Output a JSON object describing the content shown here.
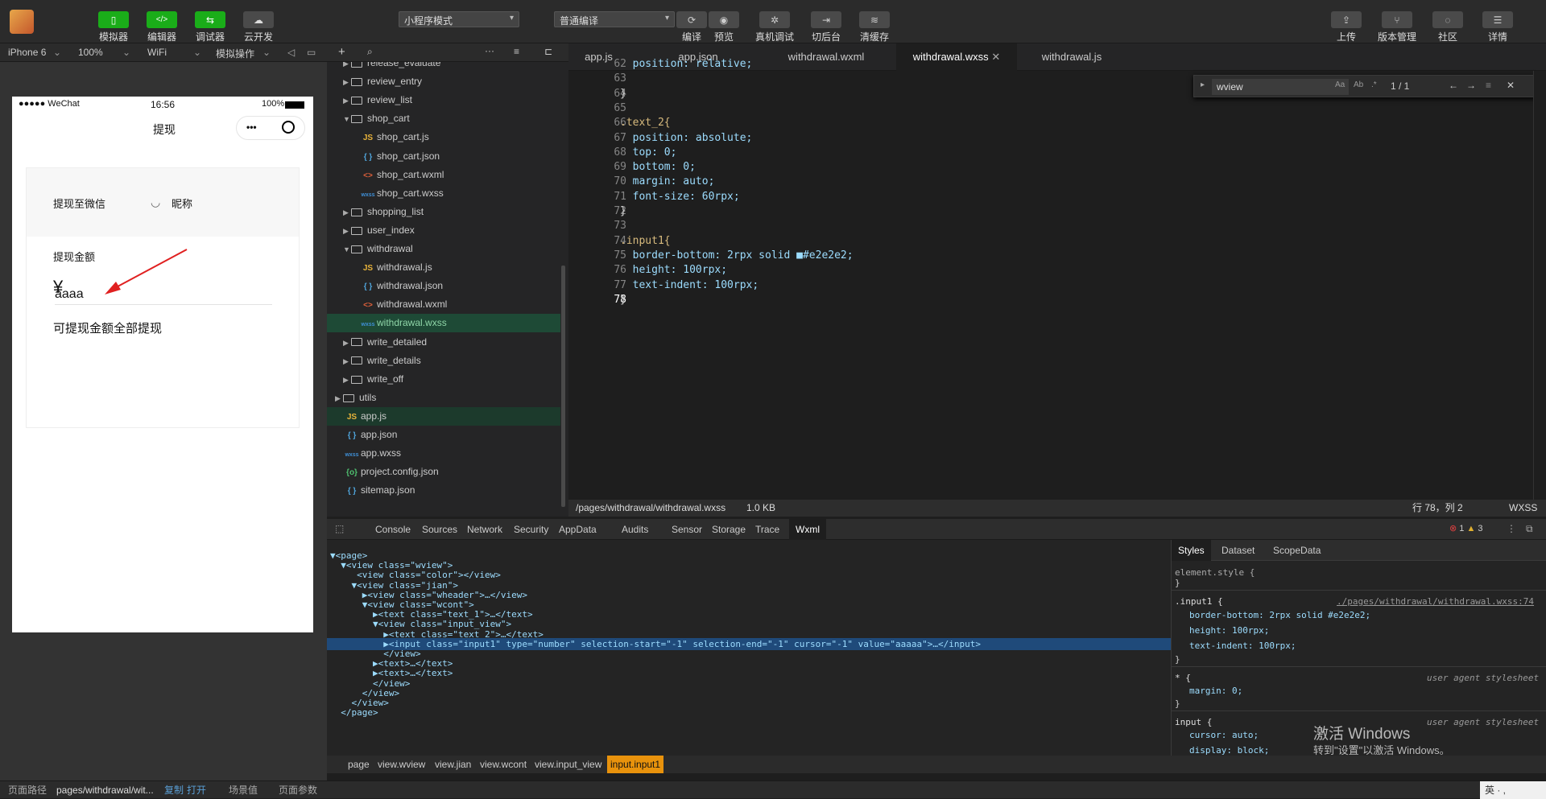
{
  "toolbar": {
    "buttons": [
      {
        "label": "模拟器"
      },
      {
        "label": "编辑器"
      },
      {
        "label": "调试器"
      },
      {
        "label": "云开发"
      }
    ],
    "mode": "小程序模式",
    "compile": "普通编译",
    "actions": [
      {
        "label": "编译"
      },
      {
        "label": "预览"
      },
      {
        "label": "真机调试"
      },
      {
        "label": "切后台"
      },
      {
        "label": "清缓存"
      }
    ],
    "right": [
      {
        "label": "上传"
      },
      {
        "label": "版本管理"
      },
      {
        "label": "社区"
      },
      {
        "label": "详情"
      }
    ]
  },
  "devbar": {
    "device": "iPhone 6",
    "zoom": "100%",
    "network": "WiFi",
    "ops": "模拟操作"
  },
  "tabs": [
    "app.js",
    "app.json",
    "withdrawal.wxml",
    "withdrawal.wxss",
    "withdrawal.js"
  ],
  "phone": {
    "signal": "●●●●● WeChat",
    "time": "16:56",
    "battery": "100%",
    "title": "提现",
    "to_wechat": "提现至微信",
    "nickname": "昵称",
    "amount_label": "提现金额",
    "yen": "¥",
    "input_value": "aaaa",
    "available": "可提现金额全部提现"
  },
  "files": [
    {
      "name": "release_evaluate",
      "type": "folder",
      "indent": 1,
      "open": false
    },
    {
      "name": "review_entry",
      "type": "folder",
      "indent": 1,
      "open": false
    },
    {
      "name": "review_list",
      "type": "folder",
      "indent": 1,
      "open": false
    },
    {
      "name": "shop_cart",
      "type": "folder",
      "indent": 1,
      "open": true
    },
    {
      "name": "shop_cart.js",
      "type": "js",
      "indent": 2
    },
    {
      "name": "shop_cart.json",
      "type": "json",
      "indent": 2
    },
    {
      "name": "shop_cart.wxml",
      "type": "wxml",
      "indent": 2
    },
    {
      "name": "shop_cart.wxss",
      "type": "wxss",
      "indent": 2
    },
    {
      "name": "shopping_list",
      "type": "folder",
      "indent": 1,
      "open": false
    },
    {
      "name": "user_index",
      "type": "folder",
      "indent": 1,
      "open": false
    },
    {
      "name": "withdrawal",
      "type": "folder",
      "indent": 1,
      "open": true
    },
    {
      "name": "withdrawal.js",
      "type": "js",
      "indent": 2
    },
    {
      "name": "withdrawal.json",
      "type": "json",
      "indent": 2
    },
    {
      "name": "withdrawal.wxml",
      "type": "wxml",
      "indent": 2
    },
    {
      "name": "withdrawal.wxss",
      "type": "wxss",
      "indent": 2
    },
    {
      "name": "write_detailed",
      "type": "folder",
      "indent": 1,
      "open": false
    },
    {
      "name": "write_details",
      "type": "folder",
      "indent": 1,
      "open": false
    },
    {
      "name": "write_off",
      "type": "folder",
      "indent": 1,
      "open": false
    },
    {
      "name": "utils",
      "type": "folder",
      "indent": 0,
      "open": false
    },
    {
      "name": "app.js",
      "type": "js",
      "indent": 0
    },
    {
      "name": "app.json",
      "type": "json",
      "indent": 0
    },
    {
      "name": "app.wxss",
      "type": "wxss",
      "indent": 0
    },
    {
      "name": "project.config.json",
      "type": "cfg",
      "indent": 0
    },
    {
      "name": "sitemap.json",
      "type": "json",
      "indent": 0
    }
  ],
  "code": [
    {
      "n": "62",
      "t": "  position: relative;"
    },
    {
      "n": "63",
      "t": ""
    },
    {
      "n": "64",
      "t": "}"
    },
    {
      "n": "65",
      "t": ""
    },
    {
      "n": "66",
      "t": ".text_2{"
    },
    {
      "n": "67",
      "t": "  position: absolute;"
    },
    {
      "n": "68",
      "t": "  top: 0;"
    },
    {
      "n": "69",
      "t": "  bottom: 0;"
    },
    {
      "n": "70",
      "t": "  margin: auto;"
    },
    {
      "n": "71",
      "t": "  font-size: 60rpx;"
    },
    {
      "n": "72",
      "t": "}"
    },
    {
      "n": "73",
      "t": ""
    },
    {
      "n": "74",
      "t": ".input1{"
    },
    {
      "n": "75",
      "t": "  border-bottom: 2rpx solid ■#e2e2e2;"
    },
    {
      "n": "76",
      "t": "  height: 100rpx;"
    },
    {
      "n": "77",
      "t": "  text-indent: 100rpx;"
    },
    {
      "n": "78",
      "t": "}"
    }
  ],
  "find": {
    "query": "wview",
    "count": "1 / 1"
  },
  "status": {
    "path": "/pages/withdrawal/withdrawal.wxss",
    "size": "1.0 KB",
    "pos": "行 78，列 2",
    "lang": "WXSS"
  },
  "devtabs": [
    "Console",
    "Sources",
    "Network",
    "Security",
    "AppData",
    "Audits",
    "Sensor",
    "Storage",
    "Trace",
    "Wxml"
  ],
  "counts": {
    "errors": "1",
    "warnings": "3"
  },
  "wxml": [
    "▼<page>",
    "  ▼<view class=\"wview\">",
    "     <view class=\"color\"></view>",
    "    ▼<view class=\"jian\">",
    "      ▶<view class=\"wheader\">…</view>",
    "      ▼<view class=\"wcont\">",
    "        ▶<text class=\"text_1\">…</text>",
    "        ▼<view class=\"input_view\">",
    "          ▶<text class=\"text_2\">…</text>",
    "          ▶<input class=\"input1\" type=\"number\" selection-start=\"-1\" selection-end=\"-1\" cursor=\"-1\" value=\"aaaaa\">…</input>",
    "          </view>",
    "        ▶<text>…</text>",
    "        ▶<text>…</text>",
    "        </view>",
    "      </view>",
    "    </view>",
    "  </page>"
  ],
  "styles": {
    "tabs": [
      "Styles",
      "Dataset",
      "ScopeData"
    ],
    "element_style": "element.style {",
    "rule1": ".input1 {",
    "rule1_src": "./pages/withdrawal/withdrawal.wxss:74",
    "props1": [
      "border-bottom: 2rpx solid #e2e2e2;",
      "height: 100rpx;",
      "text-indent: 100rpx;"
    ],
    "rule2": "* {",
    "ua": "user agent stylesheet",
    "props2": [
      "margin: 0;"
    ],
    "rule3": "input {",
    "props3": [
      "cursor: auto;",
      "display: block;"
    ]
  },
  "watermark": {
    "line1": "激活 Windows",
    "line2": "转到\"设置\"以激活 Windows。"
  },
  "breadcrumb": [
    "page",
    "view.wview",
    "view.jian",
    "view.wcont",
    "view.input_view",
    "input.input1"
  ],
  "bottom": {
    "label": "页面路径",
    "path": "pages/withdrawal/wit...",
    "copy": "复制",
    "open": "打开",
    "scene": "场景值",
    "params": "页面参数",
    "ime": "英 · ,"
  }
}
